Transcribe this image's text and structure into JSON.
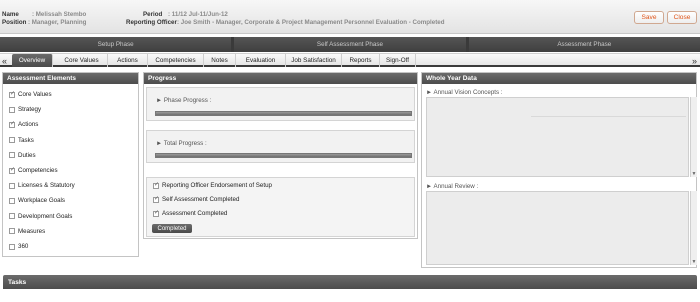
{
  "header": {
    "name_label": "Name",
    "name_value": ": Melissah Stembo",
    "position_label": "Position",
    "position_value": ": Manager, Planning",
    "period_label": "Period",
    "period_value": ": 11/12 Jul-11/Jun-12",
    "officer_label": "Reporting Officer",
    "officer_value": ": Joe Smith - Manager, Corporate & Project Management Personnel Evaluation - Completed",
    "save_label": "Save",
    "close_label": "Close"
  },
  "phases": [
    "Setup Phase",
    "Self Assessment Phase",
    "Assessment Phase"
  ],
  "tabs": [
    "Overview",
    "Core Values",
    "Actions",
    "Competencies",
    "Notes",
    "Evaluation",
    "Job Satisfaction",
    "Reports",
    "Sign-Off"
  ],
  "nav": {
    "prev": "«",
    "next": "»"
  },
  "assessment": {
    "title": "Assessment Elements",
    "items": [
      {
        "label": "Core Values",
        "checked": true
      },
      {
        "label": "Strategy",
        "checked": false
      },
      {
        "label": "Actions",
        "checked": true
      },
      {
        "label": "Tasks",
        "checked": false
      },
      {
        "label": "Duties",
        "checked": false
      },
      {
        "label": "Competencies",
        "checked": true
      },
      {
        "label": "Licenses & Statutory",
        "checked": false
      },
      {
        "label": "Workplace Goals",
        "checked": false
      },
      {
        "label": "Development Goals",
        "checked": false
      },
      {
        "label": "Measures",
        "checked": false
      },
      {
        "label": "360",
        "checked": false
      }
    ]
  },
  "progress": {
    "title": "Progress",
    "phase_label": "► Phase Progress :",
    "phase_value": 1.0,
    "total_label": "► Total Progress :",
    "total_value": 1.0,
    "checks": [
      {
        "label": "Reporting Officer Endorsement of Setup",
        "checked": true
      },
      {
        "label": "Self Assessment Completed",
        "checked": true
      },
      {
        "label": "Assessment Completed",
        "checked": true
      }
    ],
    "status_button": "Completed"
  },
  "whole_year": {
    "title": "Whole Year Data",
    "vision_label": "► Annual Vision Concepts :",
    "review_label": "► Annual Review :"
  },
  "tasks": {
    "title": "Tasks"
  }
}
